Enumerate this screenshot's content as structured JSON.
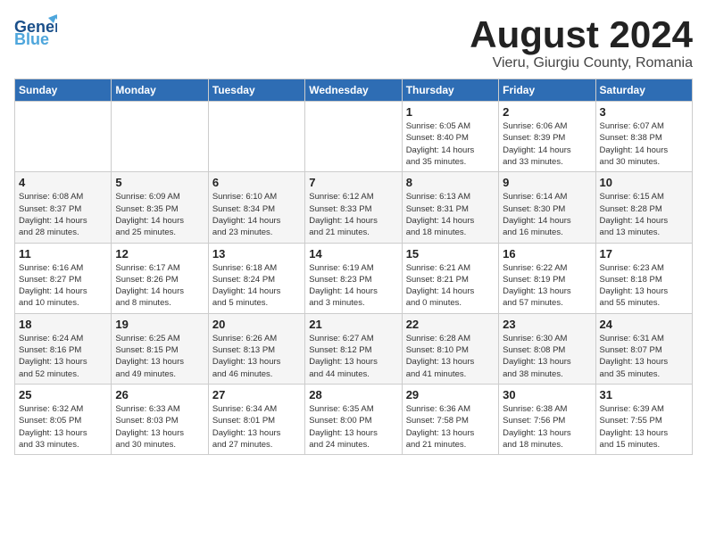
{
  "logo": {
    "line1": "General",
    "line2": "Blue"
  },
  "title": "August 2024",
  "subtitle": "Vieru, Giurgiu County, Romania",
  "weekdays": [
    "Sunday",
    "Monday",
    "Tuesday",
    "Wednesday",
    "Thursday",
    "Friday",
    "Saturday"
  ],
  "weeks": [
    [
      {
        "day": "",
        "info": ""
      },
      {
        "day": "",
        "info": ""
      },
      {
        "day": "",
        "info": ""
      },
      {
        "day": "",
        "info": ""
      },
      {
        "day": "1",
        "info": "Sunrise: 6:05 AM\nSunset: 8:40 PM\nDaylight: 14 hours\nand 35 minutes."
      },
      {
        "day": "2",
        "info": "Sunrise: 6:06 AM\nSunset: 8:39 PM\nDaylight: 14 hours\nand 33 minutes."
      },
      {
        "day": "3",
        "info": "Sunrise: 6:07 AM\nSunset: 8:38 PM\nDaylight: 14 hours\nand 30 minutes."
      }
    ],
    [
      {
        "day": "4",
        "info": "Sunrise: 6:08 AM\nSunset: 8:37 PM\nDaylight: 14 hours\nand 28 minutes."
      },
      {
        "day": "5",
        "info": "Sunrise: 6:09 AM\nSunset: 8:35 PM\nDaylight: 14 hours\nand 25 minutes."
      },
      {
        "day": "6",
        "info": "Sunrise: 6:10 AM\nSunset: 8:34 PM\nDaylight: 14 hours\nand 23 minutes."
      },
      {
        "day": "7",
        "info": "Sunrise: 6:12 AM\nSunset: 8:33 PM\nDaylight: 14 hours\nand 21 minutes."
      },
      {
        "day": "8",
        "info": "Sunrise: 6:13 AM\nSunset: 8:31 PM\nDaylight: 14 hours\nand 18 minutes."
      },
      {
        "day": "9",
        "info": "Sunrise: 6:14 AM\nSunset: 8:30 PM\nDaylight: 14 hours\nand 16 minutes."
      },
      {
        "day": "10",
        "info": "Sunrise: 6:15 AM\nSunset: 8:28 PM\nDaylight: 14 hours\nand 13 minutes."
      }
    ],
    [
      {
        "day": "11",
        "info": "Sunrise: 6:16 AM\nSunset: 8:27 PM\nDaylight: 14 hours\nand 10 minutes."
      },
      {
        "day": "12",
        "info": "Sunrise: 6:17 AM\nSunset: 8:26 PM\nDaylight: 14 hours\nand 8 minutes."
      },
      {
        "day": "13",
        "info": "Sunrise: 6:18 AM\nSunset: 8:24 PM\nDaylight: 14 hours\nand 5 minutes."
      },
      {
        "day": "14",
        "info": "Sunrise: 6:19 AM\nSunset: 8:23 PM\nDaylight: 14 hours\nand 3 minutes."
      },
      {
        "day": "15",
        "info": "Sunrise: 6:21 AM\nSunset: 8:21 PM\nDaylight: 14 hours\nand 0 minutes."
      },
      {
        "day": "16",
        "info": "Sunrise: 6:22 AM\nSunset: 8:19 PM\nDaylight: 13 hours\nand 57 minutes."
      },
      {
        "day": "17",
        "info": "Sunrise: 6:23 AM\nSunset: 8:18 PM\nDaylight: 13 hours\nand 55 minutes."
      }
    ],
    [
      {
        "day": "18",
        "info": "Sunrise: 6:24 AM\nSunset: 8:16 PM\nDaylight: 13 hours\nand 52 minutes."
      },
      {
        "day": "19",
        "info": "Sunrise: 6:25 AM\nSunset: 8:15 PM\nDaylight: 13 hours\nand 49 minutes."
      },
      {
        "day": "20",
        "info": "Sunrise: 6:26 AM\nSunset: 8:13 PM\nDaylight: 13 hours\nand 46 minutes."
      },
      {
        "day": "21",
        "info": "Sunrise: 6:27 AM\nSunset: 8:12 PM\nDaylight: 13 hours\nand 44 minutes."
      },
      {
        "day": "22",
        "info": "Sunrise: 6:28 AM\nSunset: 8:10 PM\nDaylight: 13 hours\nand 41 minutes."
      },
      {
        "day": "23",
        "info": "Sunrise: 6:30 AM\nSunset: 8:08 PM\nDaylight: 13 hours\nand 38 minutes."
      },
      {
        "day": "24",
        "info": "Sunrise: 6:31 AM\nSunset: 8:07 PM\nDaylight: 13 hours\nand 35 minutes."
      }
    ],
    [
      {
        "day": "25",
        "info": "Sunrise: 6:32 AM\nSunset: 8:05 PM\nDaylight: 13 hours\nand 33 minutes."
      },
      {
        "day": "26",
        "info": "Sunrise: 6:33 AM\nSunset: 8:03 PM\nDaylight: 13 hours\nand 30 minutes."
      },
      {
        "day": "27",
        "info": "Sunrise: 6:34 AM\nSunset: 8:01 PM\nDaylight: 13 hours\nand 27 minutes."
      },
      {
        "day": "28",
        "info": "Sunrise: 6:35 AM\nSunset: 8:00 PM\nDaylight: 13 hours\nand 24 minutes."
      },
      {
        "day": "29",
        "info": "Sunrise: 6:36 AM\nSunset: 7:58 PM\nDaylight: 13 hours\nand 21 minutes."
      },
      {
        "day": "30",
        "info": "Sunrise: 6:38 AM\nSunset: 7:56 PM\nDaylight: 13 hours\nand 18 minutes."
      },
      {
        "day": "31",
        "info": "Sunrise: 6:39 AM\nSunset: 7:55 PM\nDaylight: 13 hours\nand 15 minutes."
      }
    ]
  ]
}
